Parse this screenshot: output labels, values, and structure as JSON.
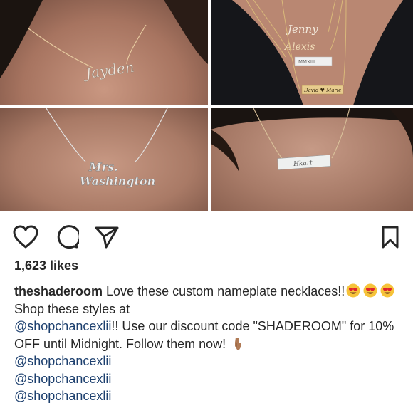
{
  "post": {
    "likes": "1,623 likes",
    "caption": {
      "username": "theshaderoom",
      "text_1": " Love these custom nameplate necklaces!!",
      "emojis": [
        "heart-eyes-emoji",
        "heart-eyes-emoji",
        "heart-eyes-emoji"
      ],
      "text_2": "  Shop these styles at ",
      "mention_1": "@shopchancexlii",
      "text_3": "!! Use our discount code \"SHADEROOM\" for 10% OFF until Midnight. Follow them now! ",
      "pointing_emoji": "pointing-down-emoji",
      "mentions": [
        "@shopchancexlii",
        "@shopchancexlii",
        "@shopchancexlii"
      ]
    }
  },
  "images": {
    "names": [
      "Jayden",
      "Jenny",
      "Alexis",
      "MMXIII",
      "David ♥ Marie",
      "Mrs.",
      "Washington",
      "Hkart"
    ]
  },
  "icons": {
    "like": "heart-icon",
    "comment": "comment-icon",
    "share": "paper-plane-icon",
    "save": "bookmark-icon"
  },
  "colors": {
    "text": "#262626",
    "mention": "#1c3f6e",
    "gold": "#d9b97a",
    "silver": "#e4e4e6"
  }
}
